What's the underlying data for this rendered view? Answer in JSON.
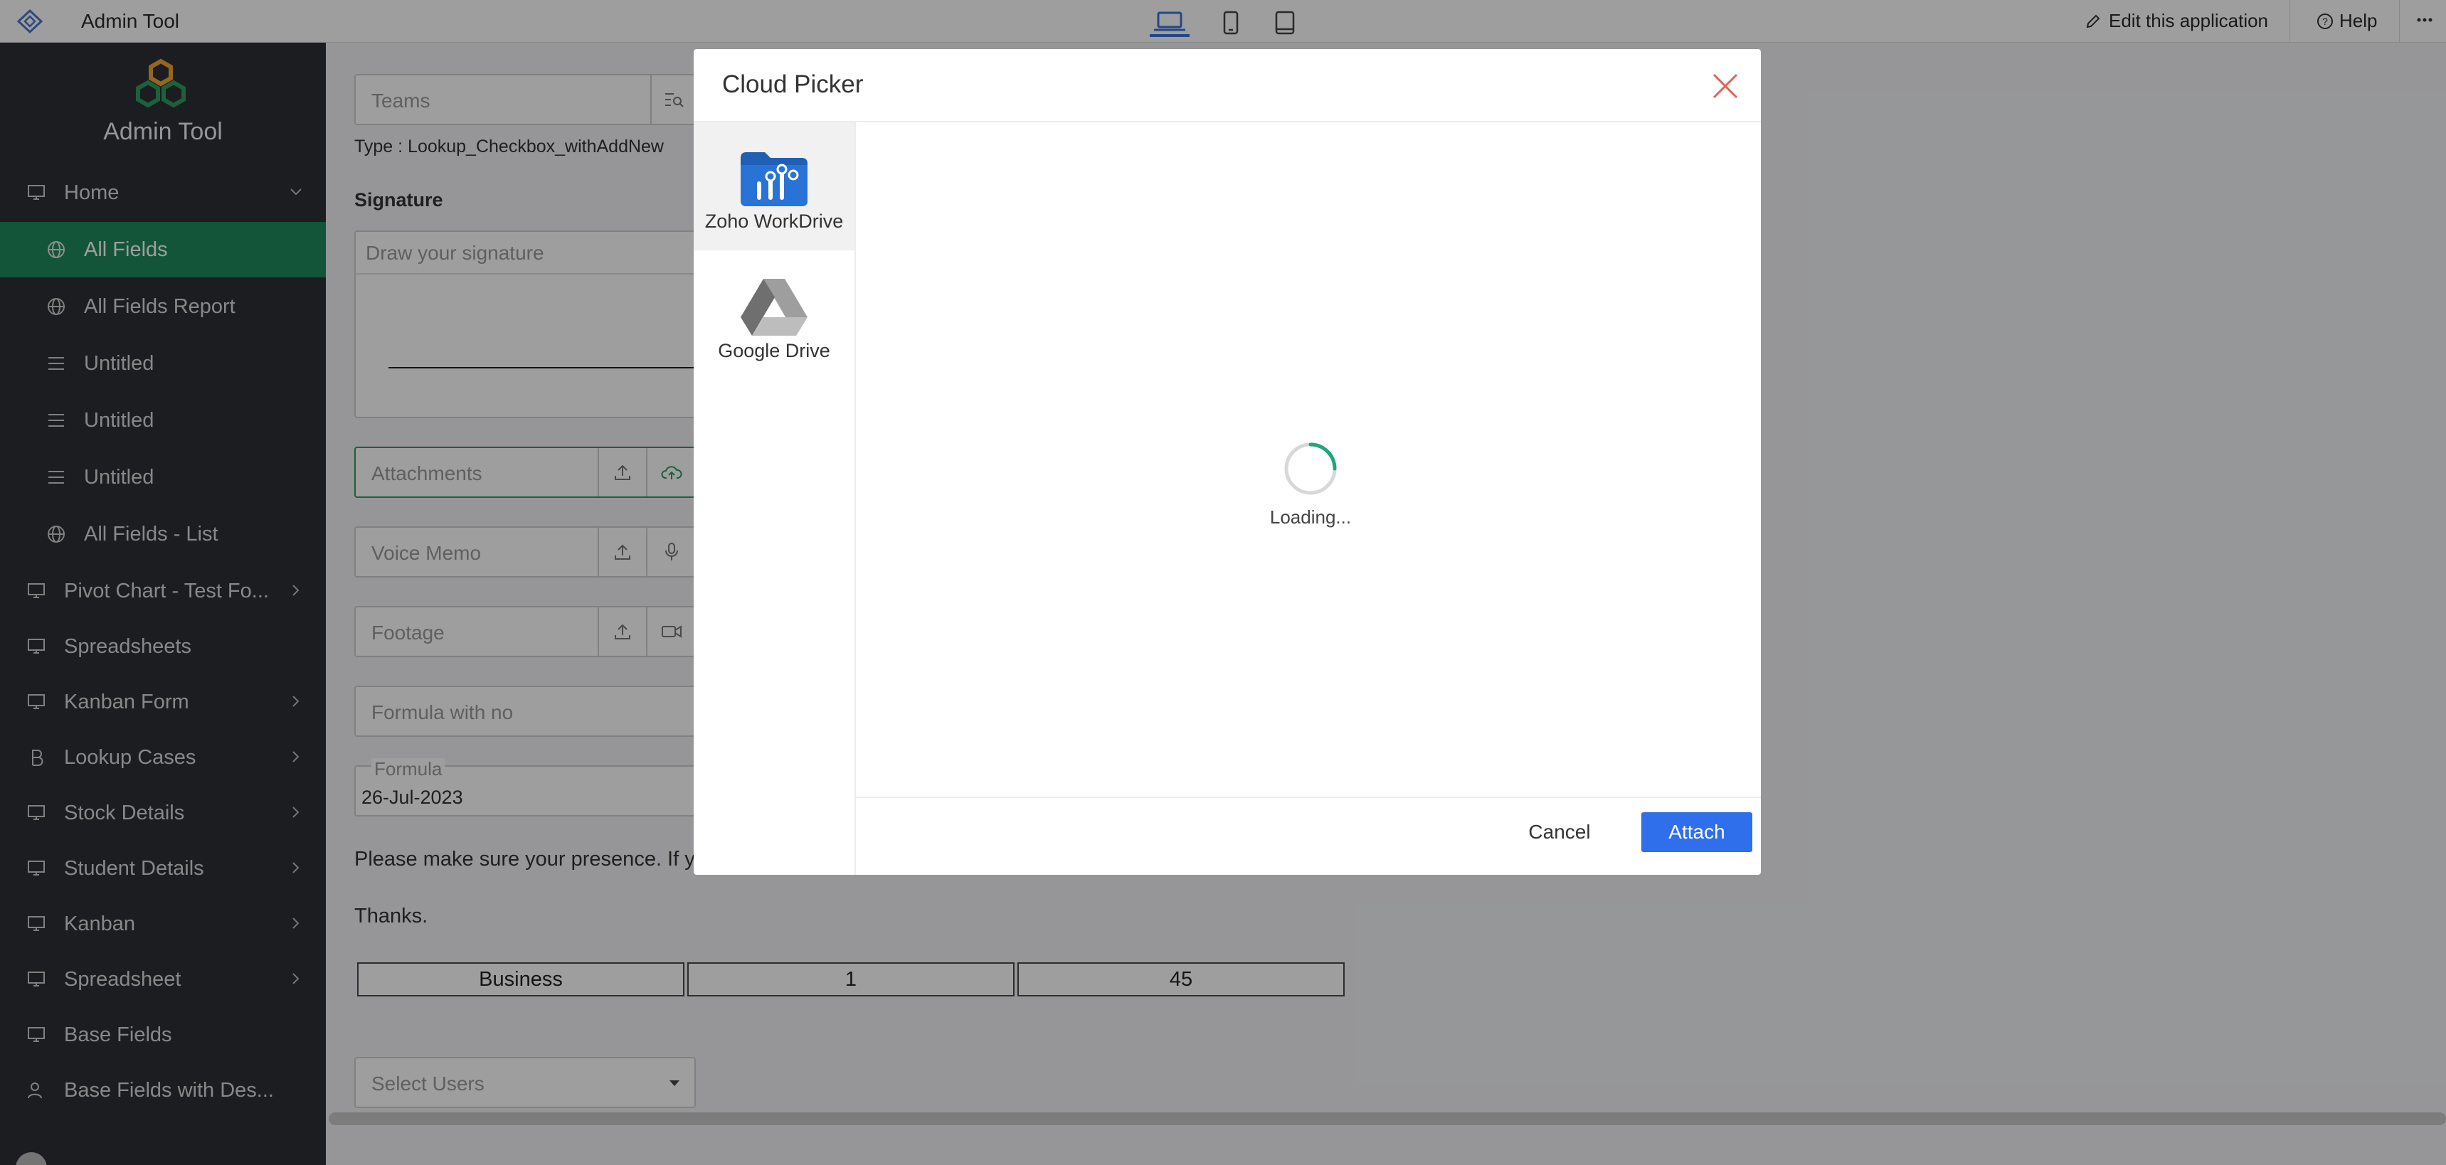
{
  "app": {
    "title": "Admin Tool"
  },
  "topbar": {
    "edit_label": "Edit this application",
    "help_label": "Help"
  },
  "sidebar": {
    "title": "Admin Tool",
    "items": [
      {
        "label": "Home",
        "icon": "monitor-icon"
      },
      {
        "label": "All Fields",
        "icon": "globe-icon"
      },
      {
        "label": "All Fields Report",
        "icon": "globe-icon"
      },
      {
        "label": "Untitled",
        "icon": "list-icon"
      },
      {
        "label": "Untitled",
        "icon": "list-icon"
      },
      {
        "label": "Untitled",
        "icon": "list-icon"
      },
      {
        "label": "All Fields - List",
        "icon": "globe-icon"
      },
      {
        "label": "Pivot Chart - Test Fo...",
        "icon": "monitor-icon"
      },
      {
        "label": "Spreadsheets",
        "icon": "monitor-icon"
      },
      {
        "label": "Kanban Form",
        "icon": "monitor-icon"
      },
      {
        "label": "Lookup Cases",
        "icon": "bitcoin-icon"
      },
      {
        "label": "Stock Details",
        "icon": "monitor-icon"
      },
      {
        "label": "Student Details",
        "icon": "monitor-icon"
      },
      {
        "label": "Kanban",
        "icon": "monitor-icon"
      },
      {
        "label": "Spreadsheet",
        "icon": "monitor-icon"
      },
      {
        "label": "Base Fields",
        "icon": "monitor-icon"
      },
      {
        "label": "Base Fields with Des...",
        "icon": "user-icon"
      }
    ]
  },
  "form": {
    "teams_placeholder": "Teams",
    "teams_type": "Type : Lookup_Checkbox_withAddNew",
    "signature_label": "Signature",
    "signature_placeholder": "Draw your signature",
    "attachments_placeholder": "Attachments",
    "voice_placeholder": "Voice Memo",
    "footage_placeholder": "Footage",
    "formula_no_placeholder": "Formula with no",
    "formula_label": "Formula",
    "formula_value": "26-Jul-2023",
    "presence_text": "Please make sure your presence. If y",
    "thanks_text": "Thanks.",
    "table_cells": [
      "Business",
      "1",
      "45"
    ],
    "select_users_placeholder": "Select Users"
  },
  "modal": {
    "title": "Cloud Picker",
    "providers": [
      {
        "name": "Zoho WorkDrive",
        "icon": "workdrive-icon"
      },
      {
        "name": "Google Drive",
        "icon": "google-drive-icon"
      }
    ],
    "loading_text": "Loading...",
    "cancel_label": "Cancel",
    "attach_label": "Attach"
  },
  "colors": {
    "active_sidebar": "#1f8a5b",
    "sidebar_bg": "#2d2f35",
    "attach_button": "#2f6fec",
    "close_icon": "#e2635b",
    "spinner_accent": "#1fa67a"
  }
}
